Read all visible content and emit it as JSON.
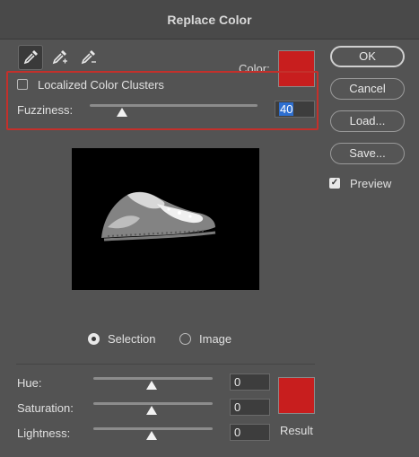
{
  "dialog": {
    "title": "Replace Color"
  },
  "eyedroppers": [
    {
      "icon": "eyedropper-icon",
      "active": true
    },
    {
      "icon": "eyedropper-plus-icon",
      "active": false
    },
    {
      "icon": "eyedropper-minus-icon",
      "active": false
    }
  ],
  "color": {
    "label": "Color:",
    "swatch": "#c81e1e"
  },
  "localized": {
    "label": "Localized Color Clusters",
    "checked": false
  },
  "fuzziness": {
    "label": "Fuzziness:",
    "value": "40",
    "level": 0.2
  },
  "view": {
    "selection_label": "Selection",
    "image_label": "Image",
    "selected": "Selection"
  },
  "adjust": {
    "hue": {
      "label": "Hue:",
      "value": "0"
    },
    "saturation": {
      "label": "Saturation:",
      "value": "0"
    },
    "lightness": {
      "label": "Lightness:",
      "value": "0"
    }
  },
  "result": {
    "label": "Result",
    "swatch": "#c81e1e"
  },
  "buttons": {
    "ok": "OK",
    "cancel": "Cancel",
    "load": "Load...",
    "save": "Save..."
  },
  "preview": {
    "label": "Preview",
    "checked": true
  },
  "accent": {
    "highlight": "#c4302b",
    "selection": "#2e6fd0"
  }
}
